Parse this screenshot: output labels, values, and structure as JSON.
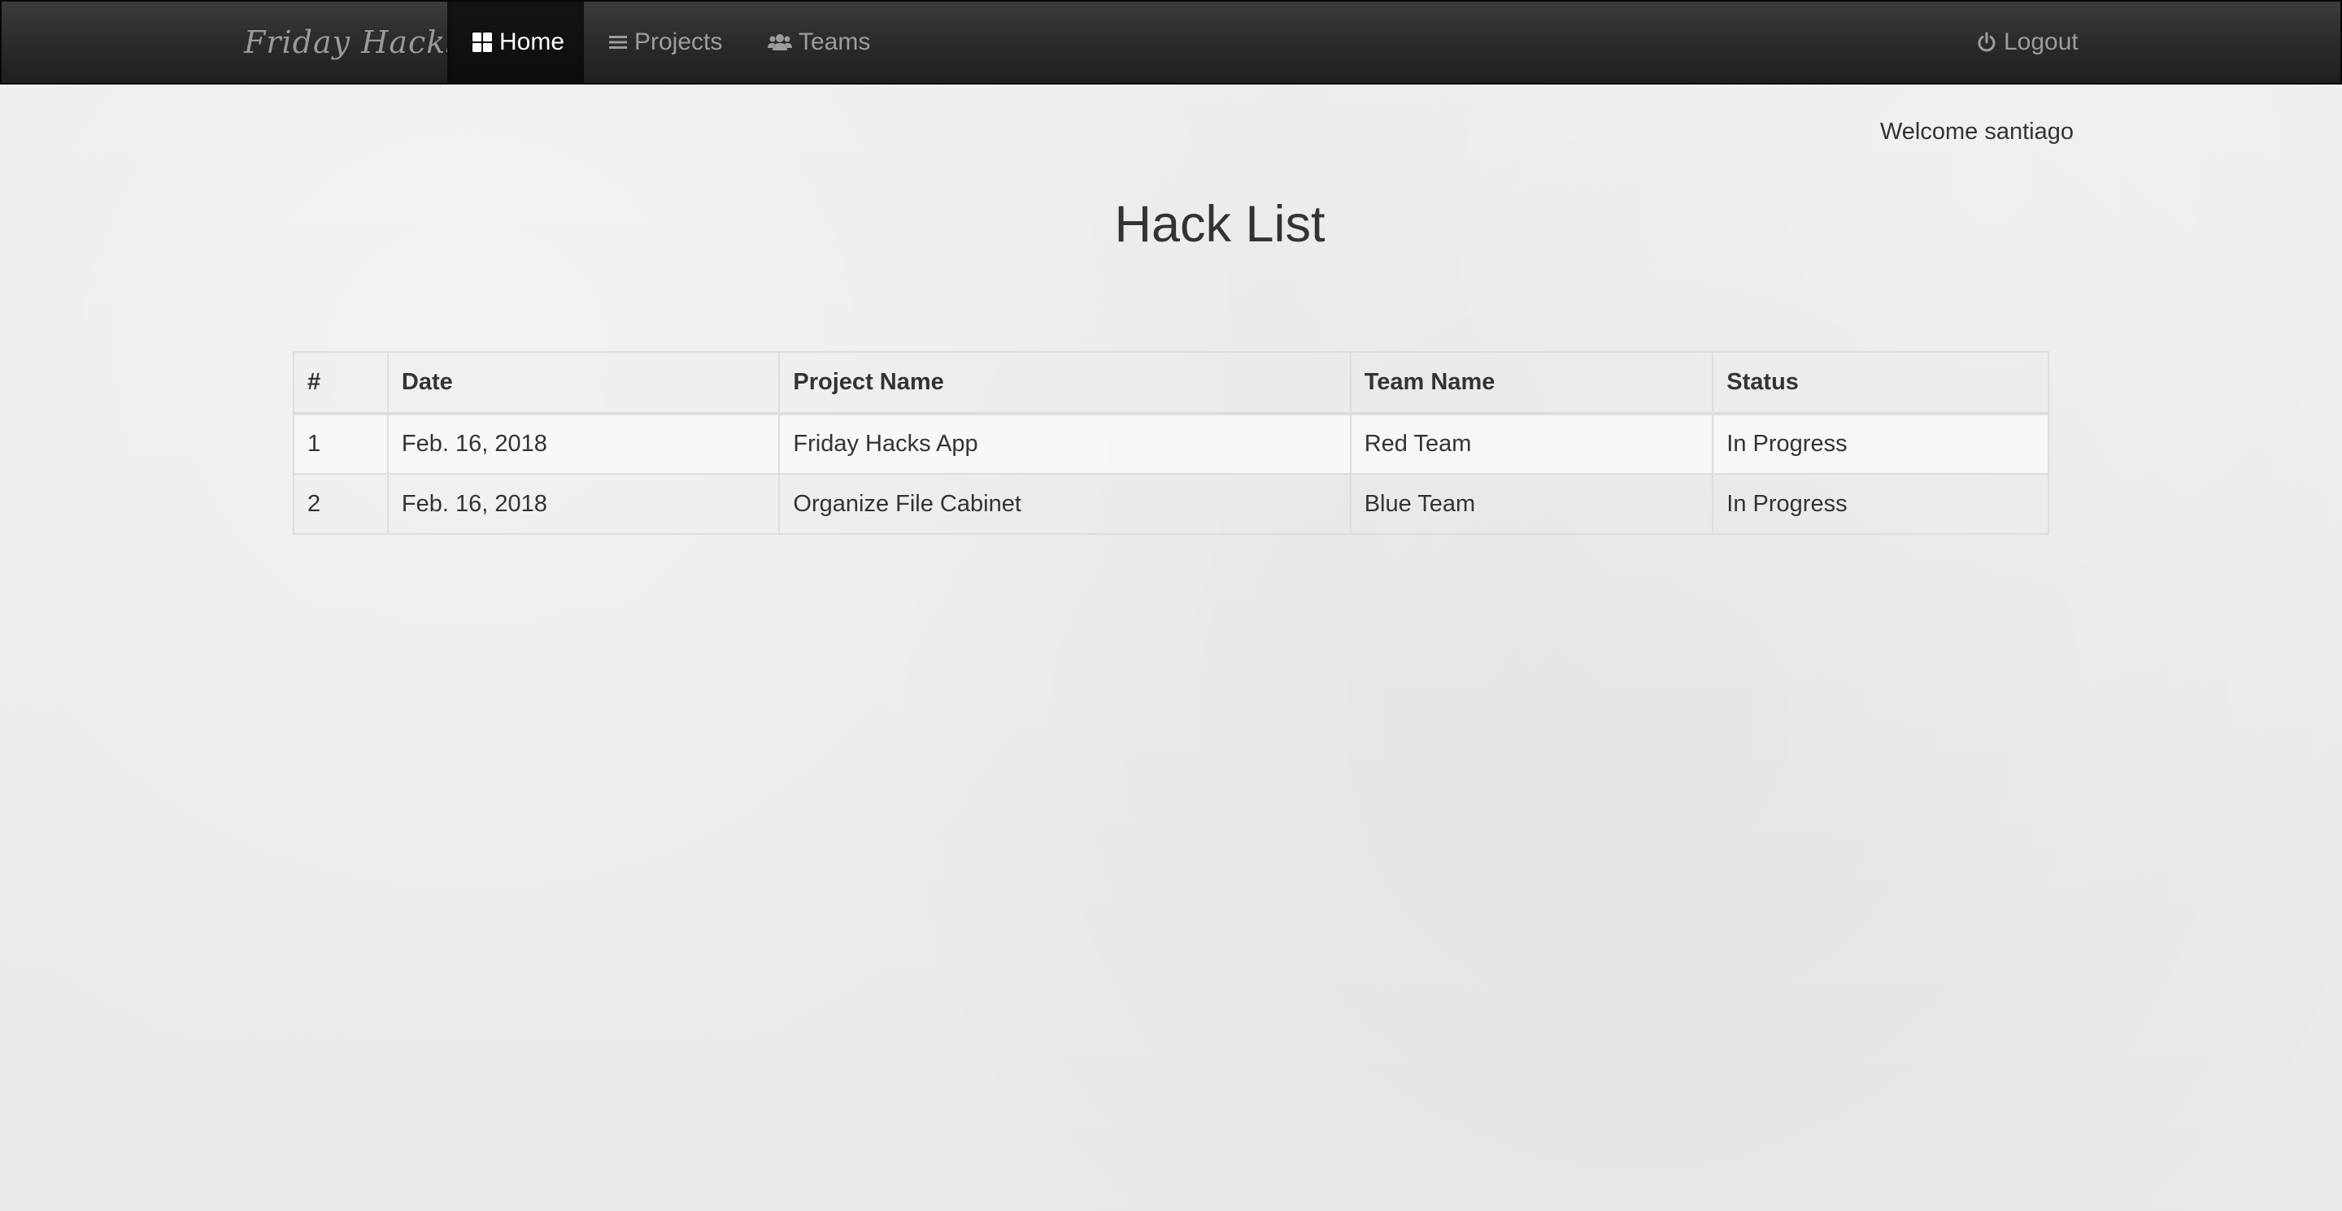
{
  "navbar": {
    "brand": "Friday Hacks",
    "items": [
      {
        "label": "Home",
        "icon": "dashboard-icon",
        "active": true
      },
      {
        "label": "Projects",
        "icon": "list-icon",
        "active": false
      },
      {
        "label": "Teams",
        "icon": "users-icon",
        "active": false
      }
    ],
    "logout": {
      "label": "Logout",
      "icon": "power-icon"
    }
  },
  "welcome": "Welcome santiago",
  "page_title": "Hack List",
  "table": {
    "headers": [
      "#",
      "Date",
      "Project Name",
      "Team Name",
      "Status"
    ],
    "rows": [
      [
        "1",
        "Feb. 16, 2018",
        "Friday Hacks App",
        "Red Team",
        "In Progress"
      ],
      [
        "2",
        "Feb. 16, 2018",
        "Organize File Cabinet",
        "Blue Team",
        "In Progress"
      ]
    ]
  },
  "colors": {
    "navbar_bg": "#222222",
    "navbar_active_bg": "#111111",
    "nav_text": "#9d9d9d",
    "nav_active_text": "#ffffff",
    "page_bg": "#ebebeb",
    "text": "#333333",
    "table_border": "#dddddd"
  }
}
